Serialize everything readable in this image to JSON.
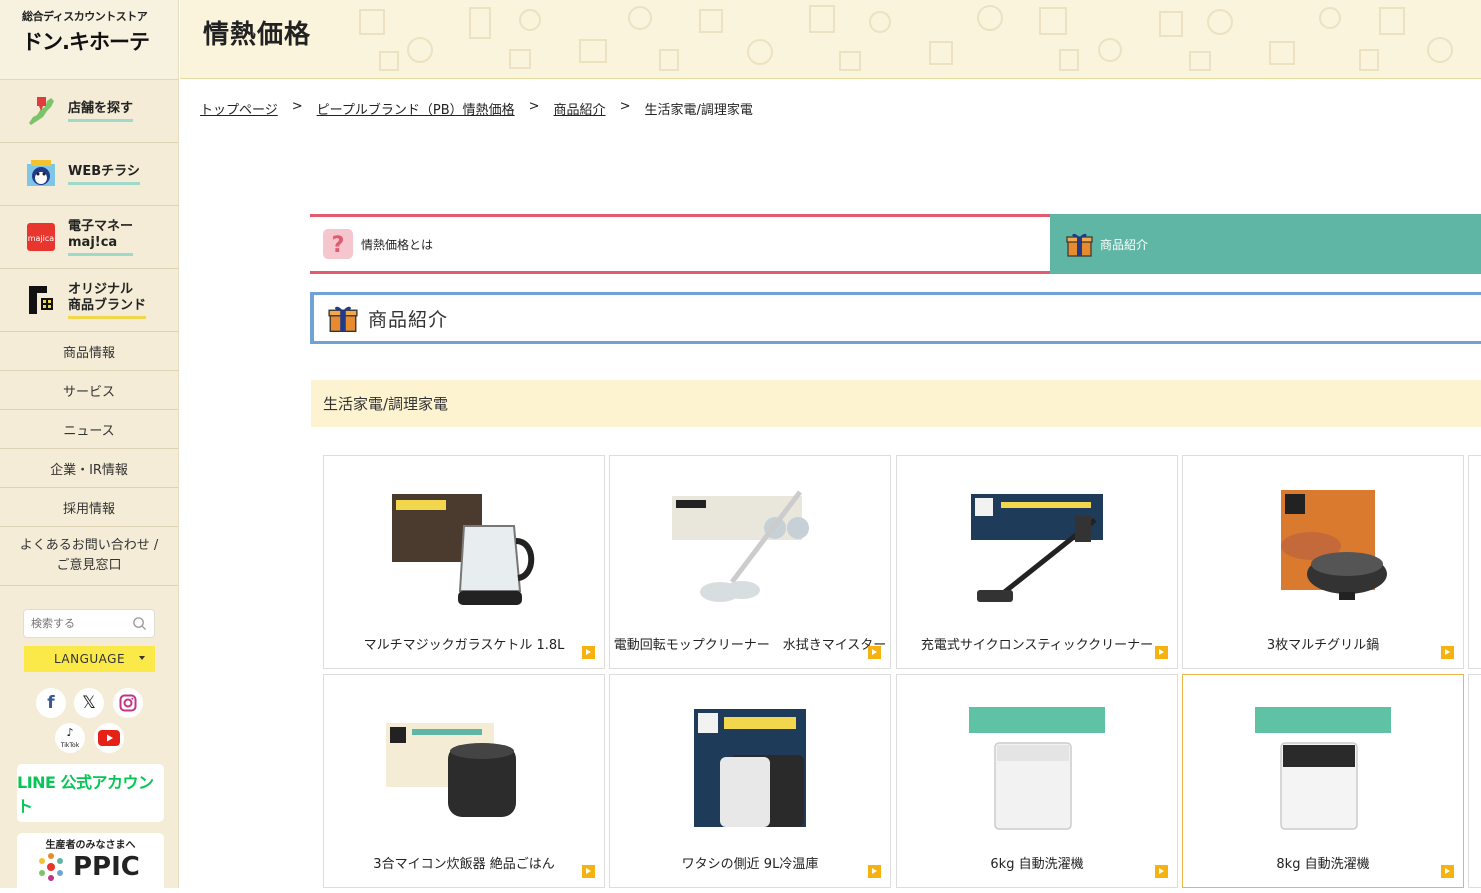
{
  "sidebar": {
    "logo_sub": "総合ディスカウントストア",
    "logo_main": "ドン.キホーテ",
    "big_menu": [
      {
        "label_1": "店舗を探す",
        "label_2": ""
      },
      {
        "label_1": "WEBチラシ",
        "label_2": ""
      },
      {
        "label_1": "電子マネー",
        "label_2": "maj!ca"
      },
      {
        "label_1": "オリジナル",
        "label_2": "商品ブランド"
      }
    ],
    "small_menu": [
      "商品情報",
      "サービス",
      "ニュース",
      "企業・IR情報",
      "採用情報"
    ],
    "contact_1": "よくあるお問い合わせ /",
    "contact_2": "ご意見窓口",
    "search_placeholder": "検索する",
    "language": "LANGUAGE",
    "tiktok_label": "TikTok",
    "line_banner": "LINE 公式アカウント",
    "ppic_caption": "生産者のみなさまへ",
    "ppic_word": "PPIC"
  },
  "header": {
    "title": "情熱価格"
  },
  "breadcrumb": [
    "トップページ",
    "ピープルブランド（PB）情熱価格",
    "商品紹介",
    "生活家電/調理家電"
  ],
  "breadcrumb_sep": ">",
  "tabs": {
    "about": "情熱価格とは",
    "products": "商品紹介"
  },
  "section_title": "商品紹介",
  "category_title": "生活家電/調理家電",
  "products": [
    "マルチマジックガラスケトル 1.8L",
    "電動回転モップクリーナー　水拭きマイスター",
    "充電式サイクロンスティッククリーナー",
    "3枚マルチグリル鍋",
    "3合マイコン炊飯器 絶品ごはん",
    "ワタシの側近 9L冷温庫",
    "6kg 自動洗濯機",
    "8kg 自動洗濯機"
  ],
  "colors": {
    "tab_about_border": "#e35a6e",
    "tab_products_bg": "#5fb6a4",
    "section_border": "#6fa3d8",
    "category_bg": "#fdf3d0",
    "language_bg": "#fbe94a"
  }
}
